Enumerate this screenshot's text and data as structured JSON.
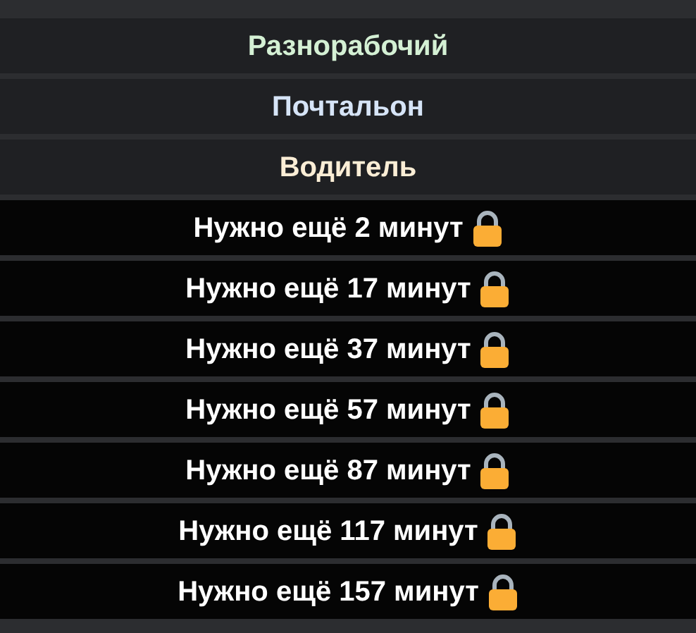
{
  "jobs": [
    {
      "kind": "open",
      "label": "Разнорабочий",
      "color": "#d4f0d4"
    },
    {
      "kind": "open",
      "label": "Почтальон",
      "color": "#d6e4f7"
    },
    {
      "kind": "open",
      "label": "Водитель",
      "color": "#fbeed6"
    },
    {
      "kind": "locked",
      "label": "Нужно ещё 2 минут"
    },
    {
      "kind": "locked",
      "label": "Нужно ещё 17 минут"
    },
    {
      "kind": "locked",
      "label": "Нужно ещё 37 минут"
    },
    {
      "kind": "locked",
      "label": "Нужно ещё 57 минут"
    },
    {
      "kind": "locked",
      "label": "Нужно ещё 87 минут"
    },
    {
      "kind": "locked",
      "label": "Нужно ещё 117 минут"
    },
    {
      "kind": "locked",
      "label": "Нужно ещё 157 минут"
    }
  ]
}
